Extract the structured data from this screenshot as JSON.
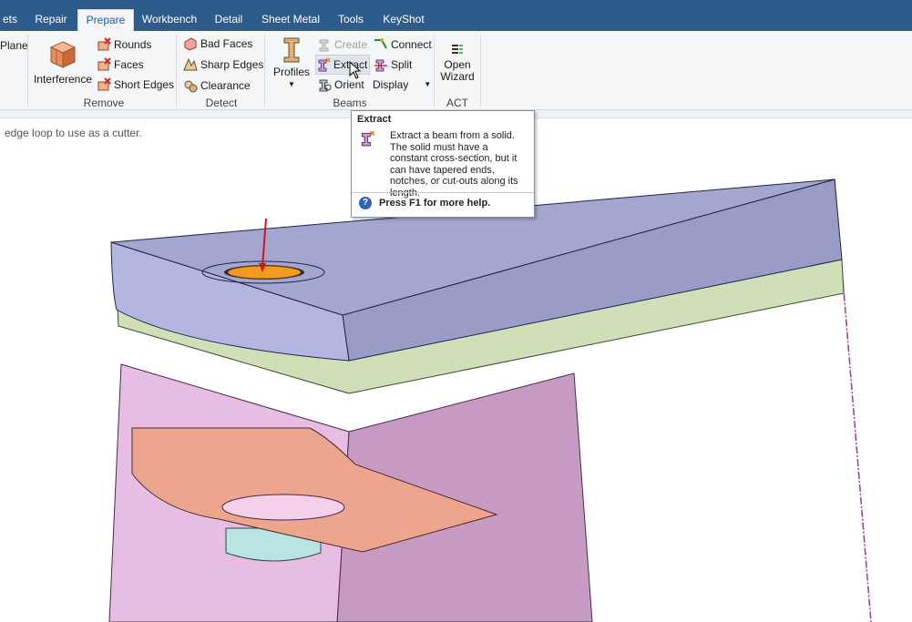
{
  "tabs": [
    {
      "label": "ets",
      "active": false
    },
    {
      "label": "Repair",
      "active": false
    },
    {
      "label": "Prepare",
      "active": true
    },
    {
      "label": "Workbench",
      "active": false
    },
    {
      "label": "Detail",
      "active": false
    },
    {
      "label": "Sheet Metal",
      "active": false
    },
    {
      "label": "Tools",
      "active": false
    },
    {
      "label": "KeyShot",
      "active": false
    }
  ],
  "ribbon": {
    "plane_label": "Plane",
    "remove": {
      "interference_label": "Interference",
      "rounds_label": "Rounds",
      "faces_label": "Faces",
      "short_edges_label": "Short Edges",
      "group_label": "Remove"
    },
    "detect": {
      "bad_faces_label": "Bad Faces",
      "sharp_edges_label": "Sharp Edges",
      "clearance_label": "Clearance",
      "group_label": "Detect"
    },
    "beams": {
      "profiles_label": "Profiles",
      "create_label": "Create",
      "extract_label": "Extract",
      "orient_label": "Orient",
      "connect_label": "Connect",
      "split_label": "Split",
      "display_label": "Display",
      "group_label": "Beams"
    },
    "act": {
      "open_wizard_line1": "Open",
      "open_wizard_line2": "Wizard",
      "group_label": "ACT"
    }
  },
  "hint_text": "edge loop to use as a cutter.",
  "tooltip": {
    "title": "Extract",
    "body": "Extract a beam from a solid. The solid must have a constant cross-section, but it can have tapered ends, notches, or cut-outs along its length.",
    "help": "Press F1 for more help."
  },
  "colors": {
    "tabbar": "#2d5b8c",
    "top_face": "#a3a6cf",
    "side_face": "#9a9cc8",
    "green_layer": "#cfe0b8",
    "pink_body": "#e3b6dc",
    "orange_feature": "#f39a20",
    "salmon_face": "#eea58e",
    "arrow": "#d0141b"
  }
}
